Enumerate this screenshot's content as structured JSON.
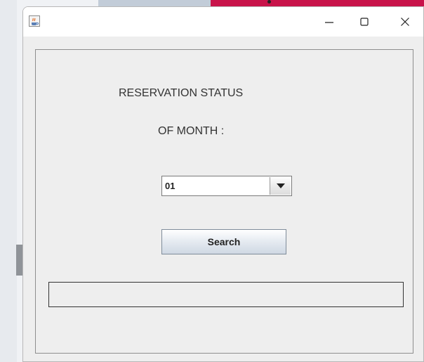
{
  "window": {
    "title": "",
    "controls": {
      "minimize": "minimize",
      "maximize": "maximize",
      "close": "close"
    }
  },
  "form": {
    "heading_line1": "RESERVATION STATUS",
    "heading_line2": "OF MONTH :",
    "month_select": {
      "selected": "01"
    },
    "search_label": "Search",
    "result_text": ""
  },
  "icons": {
    "app": "java-cup-icon",
    "minimize": "minimize-icon",
    "maximize": "maximize-icon",
    "close": "close-icon",
    "dropdown": "chevron-down-icon"
  },
  "colors": {
    "window_bg": "#eeeeee",
    "titlebar_bg": "#ffffff",
    "accent_top": "#c8134a"
  }
}
